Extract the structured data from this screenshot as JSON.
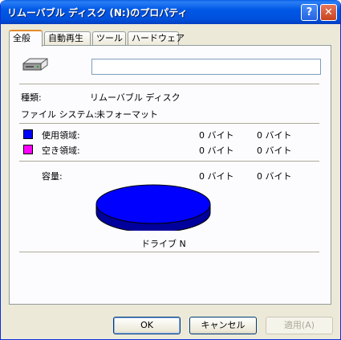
{
  "window": {
    "title": "リムーバブル ディスク (N:)のプロパティ",
    "help_label": "?",
    "close_label": "✕"
  },
  "tabs": [
    {
      "label": "全般",
      "active": true
    },
    {
      "label": "自動再生"
    },
    {
      "label": "ツール"
    },
    {
      "label": "ハードウェア"
    }
  ],
  "general": {
    "drive_icon": "removable-disk-icon",
    "name_value": "",
    "type_label": "種類:",
    "type_value": "リムーバブル ディスク",
    "fs_label": "ファイル システム:",
    "fs_value": "未フォーマット",
    "used_label": "使用領域:",
    "used_bytes": "0 バイト",
    "used_size": "0 バイト",
    "free_label": "空き領域:",
    "free_bytes": "0 バイト",
    "free_size": "0 バイト",
    "capacity_label": "容量:",
    "capacity_bytes": "0 バイト",
    "capacity_size": "0 バイト",
    "drive_label": "ドライブ N",
    "colors": {
      "used": "#0000ff",
      "free": "#ff00ff",
      "pie_side": "#00009c"
    }
  },
  "buttons": {
    "ok": "OK",
    "cancel": "キャンセル",
    "apply": "適用(A)"
  }
}
